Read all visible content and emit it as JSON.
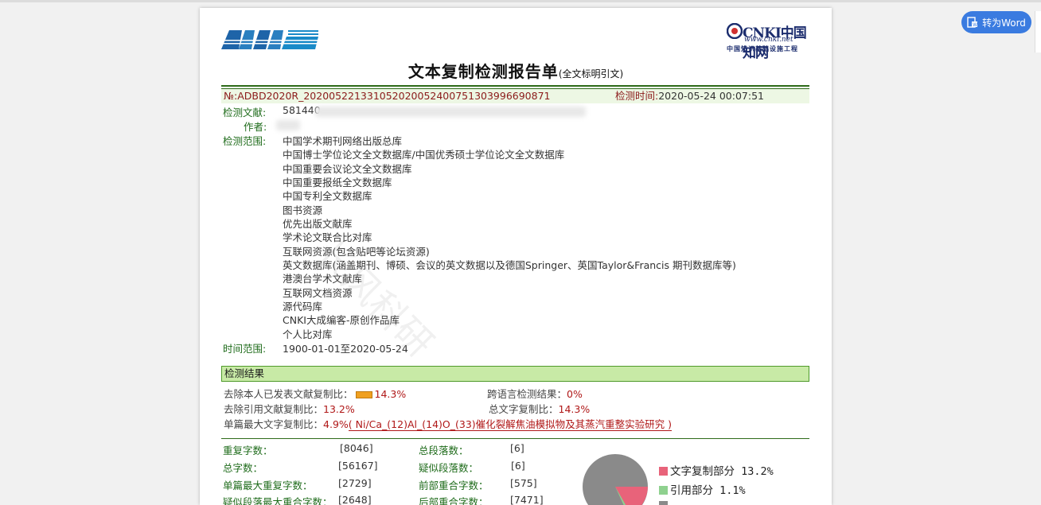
{
  "toolbar": {
    "word_button_label": "转为Word"
  },
  "header": {
    "title": "文本复制检测报告单",
    "title_note": "(全文标明引文)",
    "cnki_logo_text": "CNKI中国知网",
    "cnki_url": "www.cnki.net",
    "cnki_sub": "中国知识基础设施工程"
  },
  "report": {
    "id": "№:ADBD2020R_20200522133105202005240075130399669087​1",
    "check_time_label": "检测时间:",
    "check_time_value": "2020-05-24 00:07:51",
    "document_label": "检测文献:",
    "document_value": "581440",
    "author_label": "作者:",
    "scope_label": "检测范围:",
    "scope_items": [
      "中国学术期刊网络出版总库",
      "中国博士学位论文全文数据库/中国优秀硕士学位论文全文数据库",
      "中国重要会议论文全文数据库",
      "中国重要报纸全文数据库",
      "中国专利全文数据库",
      "图书资源",
      "优先出版文献库",
      "学术论文联合比对库",
      "互联网资源(包含贴吧等论坛资源)",
      "英文数据库(涵盖期刊、博硕、会议的英文数据以及德国Springer、英国Taylor&Francis 期刊数据库等)",
      "港澳台学术文献库",
      "互联网文档资源",
      "源代码库",
      "CNKI大成编客-原创作品库",
      "个人比对库"
    ],
    "time_range_label": "时间范围:",
    "time_range_value": "1900-01-01至2020-05-24"
  },
  "results": {
    "heading": "检测结果",
    "exclude_self_label": "去除本人已发表文献复制比：",
    "exclude_self_value": "14.3%",
    "cross_lang_label": "跨语言检测结果：",
    "cross_lang_value": "0%",
    "exclude_cite_label": "去除引用文献复制比：",
    "exclude_cite_value": "13.2%",
    "total_ratio_label": "总文字复制比：",
    "total_ratio_value": "14.3%",
    "single_max_label": "单篇最大文字复制比：",
    "single_max_value": "4.9%",
    "single_max_title": "( Ni/Ca_(12)Al_(14)O_(33)催化裂解焦油模拟物及其蒸汽重整实验研究 )"
  },
  "stats": {
    "dup_chars_label": "重复字数：",
    "dup_chars_value": "[8046]",
    "total_paras_label": "总段落数：",
    "total_paras_value": "[6]",
    "total_chars_label": "总字数：",
    "total_chars_value": "[56167]",
    "sus_paras_label": "疑似段落数：",
    "sus_paras_value": "[6]",
    "single_max_dup_label": "单篇最大重复字数：",
    "single_max_dup_value": "[2729]",
    "front_overlap_label": "前部重合字数：",
    "front_overlap_value": "[575]",
    "sus_para_max_label": "疑似段落最大重合字数：",
    "sus_para_max_value": "[2648]",
    "back_overlap_label": "后部重合字数：",
    "back_overlap_value": "[7471]"
  },
  "pie": {
    "legend": [
      {
        "label": "文字复制部分",
        "value": "13.2%",
        "color": "#e8637a"
      },
      {
        "label": "引用部分",
        "value": "1.1%",
        "color": "#8fd18f"
      }
    ],
    "base_color": "#8a8a8a"
  },
  "watermark": "长风科研"
}
